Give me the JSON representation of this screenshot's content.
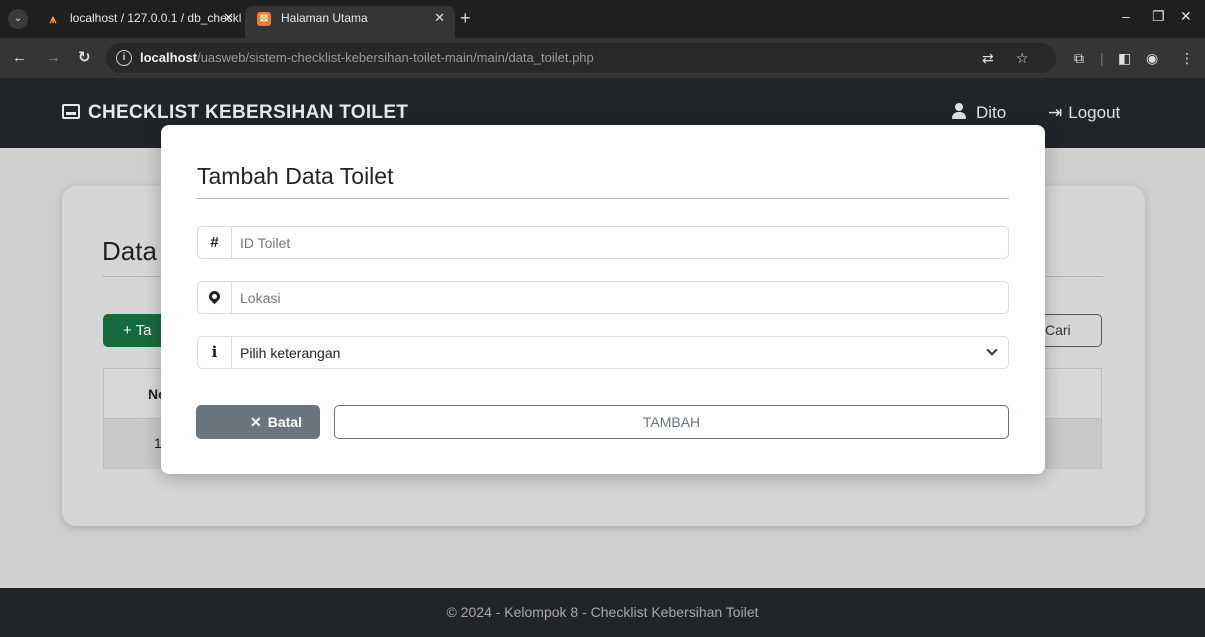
{
  "browser": {
    "tabs": [
      {
        "title": "localhost / 127.0.0.1 / db_checkl",
        "favicon": "phpmyadmin-icon"
      },
      {
        "title": "Halaman Utama",
        "favicon": "xampp-icon"
      }
    ],
    "url_host": "localhost",
    "url_path": "/uasweb/sistem-checklist-kebersihan-toilet-main/main/data_toilet.php"
  },
  "navbar": {
    "brand": "CHECKLIST KEBERSIHAN TOILET",
    "user": "Dito",
    "logout": "Logout"
  },
  "page": {
    "title": "Data",
    "add_button": "+ Ta",
    "search_button": "Cari",
    "table_header_first": "No",
    "table_first_cell": "1"
  },
  "modal": {
    "title": "Tambah Data Toilet",
    "id_placeholder": "ID Toilet",
    "lokasi_placeholder": "Lokasi",
    "keterangan_selected": "Pilih keterangan",
    "cancel_label": "Batal",
    "submit_label": "TAMBAH"
  },
  "footer": {
    "text": "© 2024 - Kelompok 8 - Checklist Kebersihan Toilet"
  },
  "colors": {
    "navbar": "#212529",
    "success": "#176a3e",
    "secondary": "#6c757d"
  }
}
